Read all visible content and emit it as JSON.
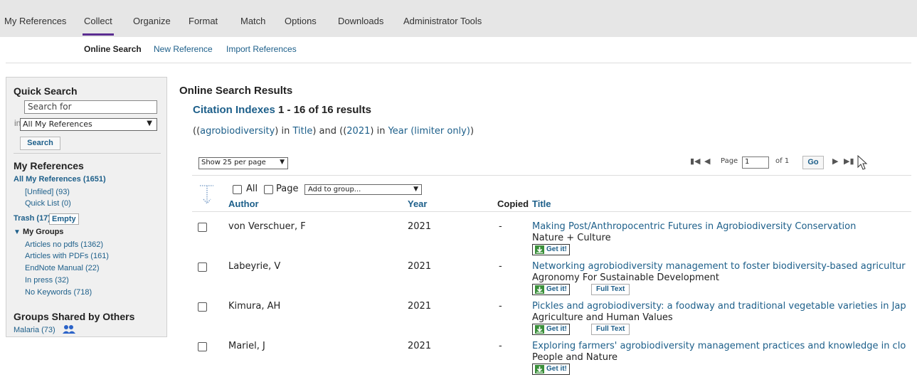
{
  "topnav": {
    "items": [
      "My References",
      "Collect",
      "Organize",
      "Format",
      "Match",
      "Options",
      "Downloads",
      "Administrator Tools"
    ],
    "active": "Collect"
  },
  "subnav": {
    "items": [
      "Online Search",
      "New Reference",
      "Import References"
    ],
    "active": "Online Search"
  },
  "sidebar": {
    "quick_search_title": "Quick Search",
    "search_placeholder": "Search for",
    "in_label": "in",
    "scope_value": "All My References",
    "search_button": "Search",
    "my_refs_title": "My References",
    "all_refs": "All My References (1651)",
    "unfiled": "[Unfiled] (93)",
    "quick_list": "Quick List (0)",
    "trash": "Trash (17)",
    "empty_button": "Empty",
    "my_groups": "My Groups",
    "groups": [
      "Articles no pdfs (1362)",
      "Articles with PDFs (161)",
      "EndNote Manual (22)",
      "In press (32)",
      "No Keywords (718)"
    ],
    "shared_title": "Groups Shared by Others",
    "shared_group": "Malaria (73)"
  },
  "main": {
    "title": "Online Search Results",
    "source": "Citation Indexes",
    "count_text": "1 - 16 of 16 results",
    "query": {
      "p1": "((",
      "term1": "agrobiodiversity",
      "p2": ") in ",
      "field1": "Title",
      "p3": ") and ((",
      "term2": "2021",
      "p4": ") in ",
      "field2": "Year (limiter only)",
      "p5": ")"
    },
    "per_page": "Show 25 per page",
    "pager": {
      "page_label": "Page",
      "page_value": "1",
      "of_label": "of 1",
      "go": "Go"
    },
    "select_all": "All",
    "select_page": "Page",
    "add_to_group": "Add to group...",
    "columns": {
      "author": "Author",
      "year": "Year",
      "copied": "Copied",
      "title": "Title"
    },
    "get_it": "Get it!",
    "full_text": "Full Text",
    "rows": [
      {
        "author": "von Verschuer, F",
        "year": "2021",
        "copied": "-",
        "title": "Making Post/Anthropocentric Futures in Agrobiodiversity Conservation",
        "journal": "Nature + Culture",
        "full_text": false
      },
      {
        "author": "Labeyrie, V",
        "year": "2021",
        "copied": "-",
        "title": "Networking agrobiodiversity management to foster biodiversity-based agricultur",
        "journal": "Agronomy For Sustainable Development",
        "full_text": true
      },
      {
        "author": "Kimura, AH",
        "year": "2021",
        "copied": "-",
        "title": "Pickles and agrobiodiversity: a foodway and traditional vegetable varieties in Jap",
        "journal": "Agriculture and Human Values",
        "full_text": true
      },
      {
        "author": "Mariel, J",
        "year": "2021",
        "copied": "-",
        "title": "Exploring farmers' agrobiodiversity management practices and knowledge in clo",
        "journal": "People and Nature",
        "full_text": false
      }
    ]
  },
  "colors": {
    "link": "#1d5f8a",
    "accent": "#5b2d91",
    "nav_bg": "#e6e6e6"
  }
}
